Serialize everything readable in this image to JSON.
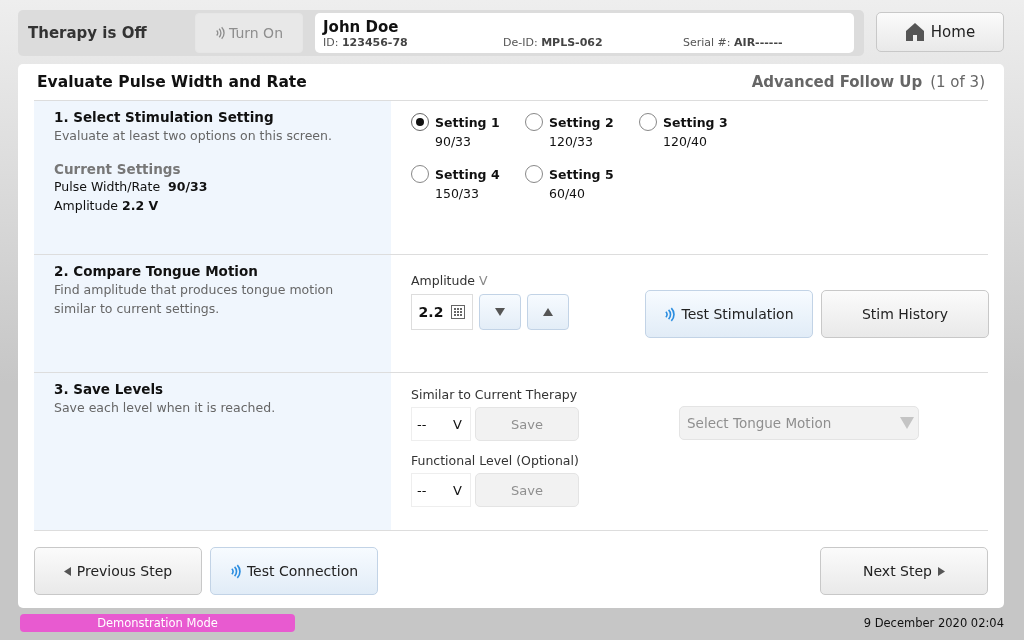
{
  "header": {
    "therapy_status": "Therapy is Off",
    "turn_on_button": {
      "label": "Turn On",
      "disabled": true
    },
    "patient": {
      "name": "John Doe",
      "id_label": "ID:",
      "id": "123456-78",
      "deid_label": "De-ID:",
      "deid": "MPLS-062",
      "serial_label": "Serial #:",
      "serial": "AIR------"
    },
    "home_button": "Home"
  },
  "page": {
    "title": "Evaluate Pulse Width and Rate",
    "flow": "Advanced Follow Up",
    "step": "(1 of 3)"
  },
  "section_1": {
    "heading": "1. Select Stimulation Setting",
    "description": "Evaluate at least two options on this screen.",
    "current_settings": {
      "heading": "Current Settings",
      "pulse_label": "Pulse Width/Rate",
      "pulse_value": "90/33",
      "amplitude_label": "Amplitude",
      "amplitude_value": "2.2 V"
    },
    "settings": [
      {
        "name": "Setting 1",
        "value": "90/33",
        "selected": true
      },
      {
        "name": "Setting 2",
        "value": "120/33",
        "selected": false
      },
      {
        "name": "Setting 3",
        "value": "120/40",
        "selected": false
      },
      {
        "name": "Setting 4",
        "value": "150/33",
        "selected": false
      },
      {
        "name": "Setting 5",
        "value": "60/40",
        "selected": false
      }
    ]
  },
  "section_2": {
    "heading": "2. Compare Tongue Motion",
    "description": "Find amplitude that produces tongue motion similar to current settings.",
    "amplitude_label": "Amplitude",
    "amplitude_unit": "V",
    "amplitude_value": "2.2",
    "test_button": "Test Stimulation",
    "history_button": "Stim History"
  },
  "section_3": {
    "heading": "3. Save Levels",
    "description": "Save each level when it is reached.",
    "levels": [
      {
        "label": "Similar to Current Therapy",
        "value": "--",
        "unit": "V",
        "save": "Save",
        "save_disabled": true
      },
      {
        "label": "Functional Level (Optional)",
        "value": "--",
        "unit": "V",
        "save": "Save",
        "save_disabled": true
      }
    ],
    "dropdown": {
      "placeholder": "Select Tongue Motion",
      "disabled": true
    }
  },
  "footer": {
    "previous_button": "Previous Step",
    "connection_button": "Test Connection",
    "next_button": "Next Step"
  },
  "status_bar": {
    "mode": "Demonstration Mode",
    "datetime": "9 December 2020 02:04"
  }
}
